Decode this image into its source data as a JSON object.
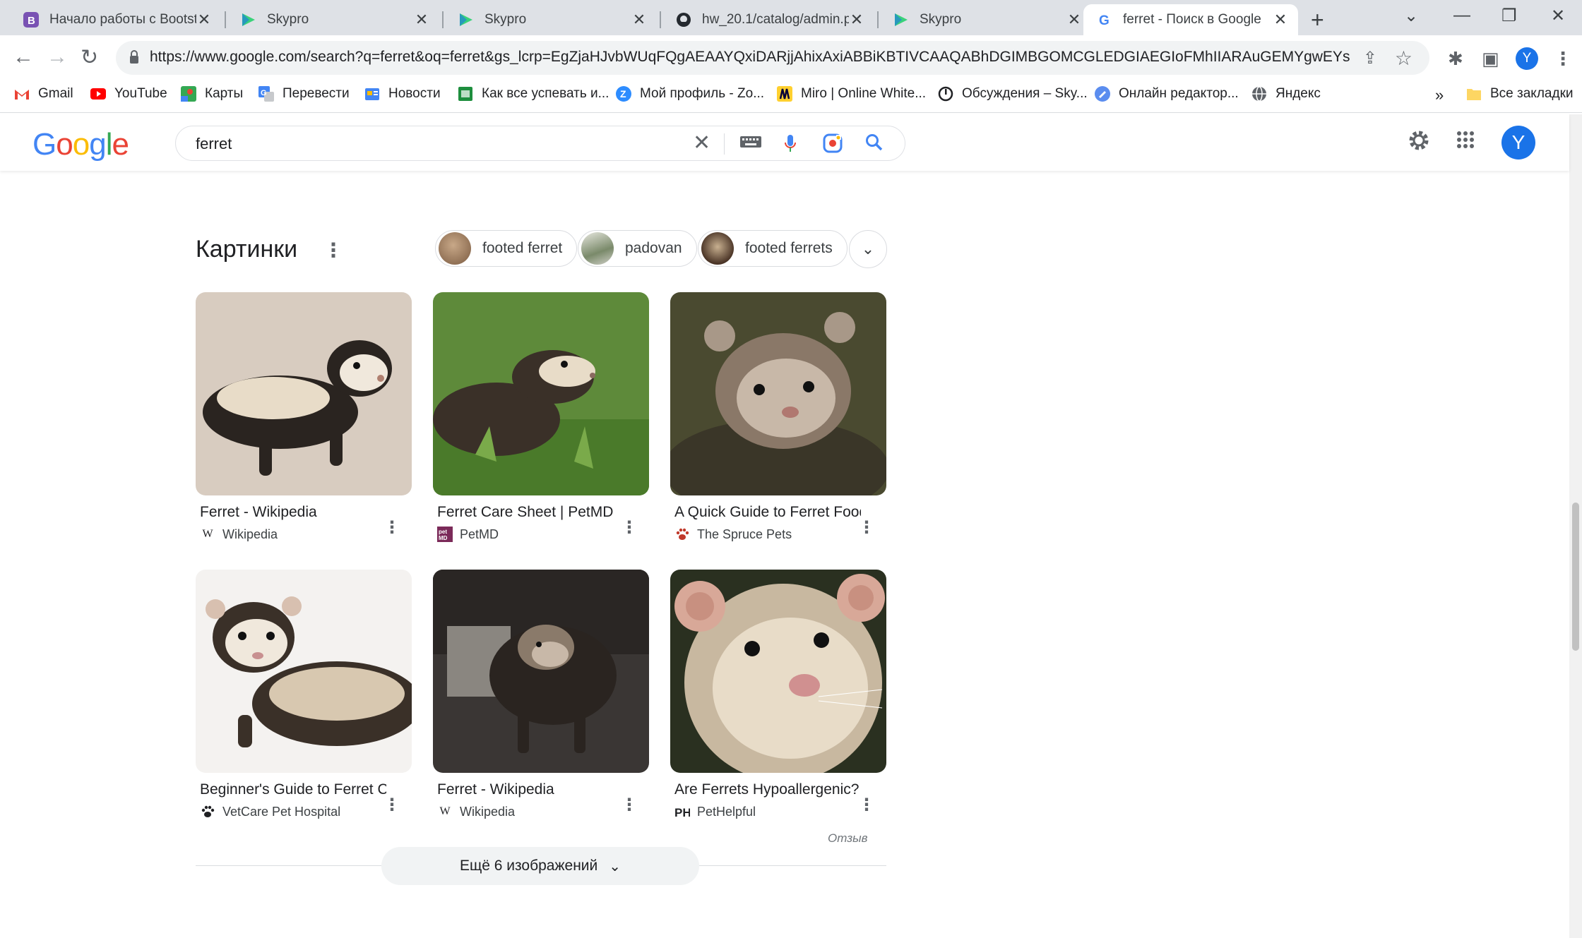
{
  "browser": {
    "tabs": [
      {
        "title": "Начало работы с Bootstr",
        "favicon": "bootstrap-icon",
        "color": "#7952b3"
      },
      {
        "title": "Skypro",
        "favicon": "skypro-icon",
        "color": "#3ad27a"
      },
      {
        "title": "Skypro",
        "favicon": "skypro-icon",
        "color": "#3ad27a"
      },
      {
        "title": "hw_20.1/catalog/admin.p",
        "favicon": "github-icon",
        "color": "#24292f"
      },
      {
        "title": "Skypro",
        "favicon": "skypro-icon",
        "color": "#3ad27a"
      },
      {
        "title": "ferret - Поиск в Google",
        "favicon": "google-icon",
        "color": "#4285f4"
      }
    ],
    "url": "https://www.google.com/search?q=ferret&oq=ferret&gs_lcrp=EgZjaHJvbWUqFQgAEAAYQxiDARjjAhixAxiABBiKBTIVCAAQABhDGIMBGOMCGLEDGIAEGIoFMhIIARAuGEMYgwEYsQMYg...",
    "profile_initial": "Y",
    "bookmarks": [
      {
        "label": "Gmail",
        "icon": "gmail-icon",
        "color": "#ea4335"
      },
      {
        "label": "YouTube",
        "icon": "youtube-icon",
        "color": "#ff0000"
      },
      {
        "label": "Карты",
        "icon": "maps-icon",
        "color": "#34a853"
      },
      {
        "label": "Перевести",
        "icon": "translate-icon",
        "color": "#4285f4"
      },
      {
        "label": "Новости",
        "icon": "news-icon",
        "color": "#4285f4"
      },
      {
        "label": "Как все успевать и...",
        "icon": "bookmark-folder-icon",
        "color": "#1e8e3e"
      },
      {
        "label": "Мой профиль - Zo...",
        "icon": "zoom-icon",
        "color": "#2d8cff"
      },
      {
        "label": "Miro | Online White...",
        "icon": "miro-icon",
        "color": "#ffd02f"
      },
      {
        "label": "Обсуждения – Sky...",
        "icon": "discussion-icon",
        "color": "#202124"
      },
      {
        "label": "Онлайн редактор...",
        "icon": "editor-icon",
        "color": "#5b8def"
      },
      {
        "label": "Яндекс",
        "icon": "globe-icon",
        "color": "#5f6368"
      }
    ],
    "all_bookmarks": "Все закладки"
  },
  "google": {
    "query": "ferret",
    "profile_initial": "Y"
  },
  "images_section": {
    "title": "Картинки",
    "chips": [
      {
        "label": "footed ferret",
        "color": "#a08060"
      },
      {
        "label": "padovan",
        "color": "#7a8a6a"
      },
      {
        "label": "footed ferrets",
        "color": "#6a5040"
      }
    ],
    "results": [
      {
        "title": "Ferret - Wikipedia",
        "source": "Wikipedia",
        "source_icon": "wikipedia-icon",
        "bg": "#d8ccc0",
        "fg": "#2a2420"
      },
      {
        "title": "Ferret Care Sheet | PetMD",
        "source": "PetMD",
        "source_icon": "petmd-icon",
        "bg": "#5e8a3a",
        "fg": "#3a3028"
      },
      {
        "title": "A Quick Guide to Ferret Food...",
        "source": "The Spruce Pets",
        "source_icon": "paw-icon",
        "bg": "#4a4a30",
        "fg": "#b8a898"
      },
      {
        "title": "Beginner's Guide to Ferret Ca...",
        "source": "VetCare Pet Hospital",
        "source_icon": "paw-icon",
        "bg": "#f4f2f0",
        "fg": "#3a3028"
      },
      {
        "title": "Ferret - Wikipedia",
        "source": "Wikipedia",
        "source_icon": "wikipedia-icon",
        "bg": "#3a3634",
        "fg": "#2a2420"
      },
      {
        "title": "Are Ferrets Hypoallergenic? ...",
        "source": "PetHelpful",
        "source_icon": "pethelpful-icon",
        "bg": "#2a3020",
        "fg": "#d8c8b8"
      }
    ],
    "feedback": "Отзыв",
    "more_button": "Ещё 6 изображений"
  }
}
